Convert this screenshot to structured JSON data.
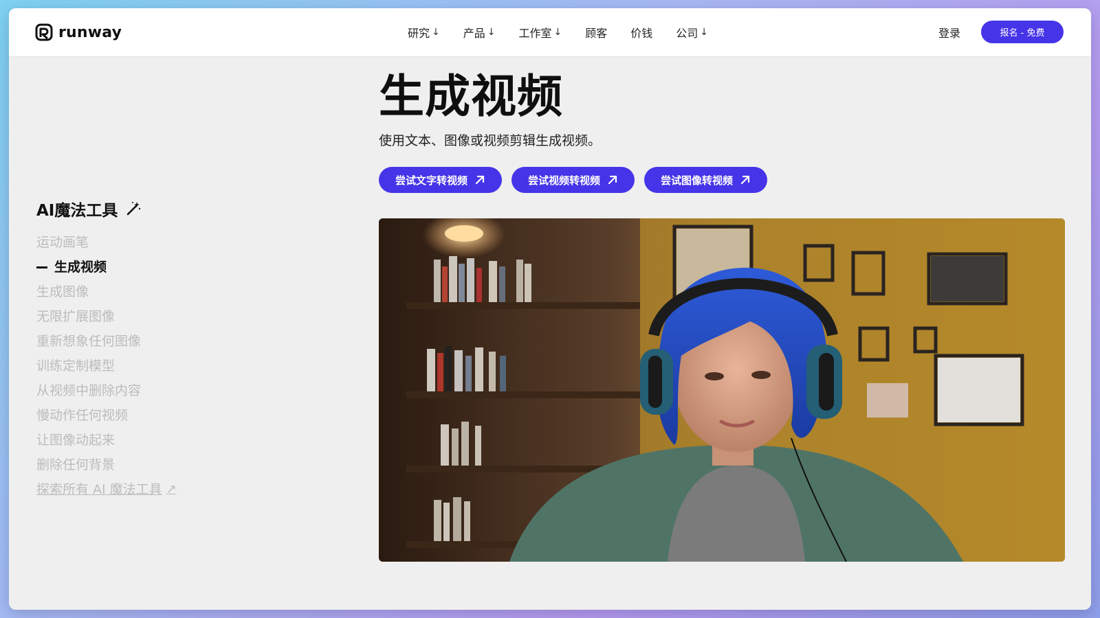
{
  "brand": {
    "name": "runway"
  },
  "nav": {
    "items": [
      {
        "label": "研究",
        "arrow": "↓"
      },
      {
        "label": "产品",
        "arrow": "↓"
      },
      {
        "label": "工作室",
        "arrow": "↓"
      },
      {
        "label": "顾客",
        "arrow": ""
      },
      {
        "label": "价钱",
        "arrow": ""
      },
      {
        "label": "公司",
        "arrow": "↓"
      }
    ],
    "login": "登录",
    "signup": "报名 - 免费"
  },
  "sidebar": {
    "heading": "AI魔法工具",
    "items": [
      {
        "label": "运动画笔",
        "active": false
      },
      {
        "label": "生成视频",
        "active": true
      },
      {
        "label": "生成图像",
        "active": false
      },
      {
        "label": "无限扩展图像",
        "active": false
      },
      {
        "label": "重新想象任何图像",
        "active": false
      },
      {
        "label": "训练定制模型",
        "active": false
      },
      {
        "label": "从视频中删除内容",
        "active": false
      },
      {
        "label": "慢动作任何视频",
        "active": false
      },
      {
        "label": "让图像动起来",
        "active": false
      },
      {
        "label": "删除任何背景",
        "active": false
      }
    ],
    "explore": "探索所有 AI 魔法工具",
    "explore_icon": "↗"
  },
  "main": {
    "title": "生成视频",
    "subtitle": "使用文本、图像或视频剪辑生成视频。",
    "ctas": [
      {
        "label": "尝试文字转视频"
      },
      {
        "label": "尝试视频转视频"
      },
      {
        "label": "尝试图像转视频"
      }
    ]
  },
  "colors": {
    "accent": "#4634e8",
    "muted": "#bcbcbc"
  },
  "icons": {
    "logo": "runway-logo-icon",
    "wand": "magic-wand-icon",
    "cta": "arrow-up-right-icon"
  }
}
